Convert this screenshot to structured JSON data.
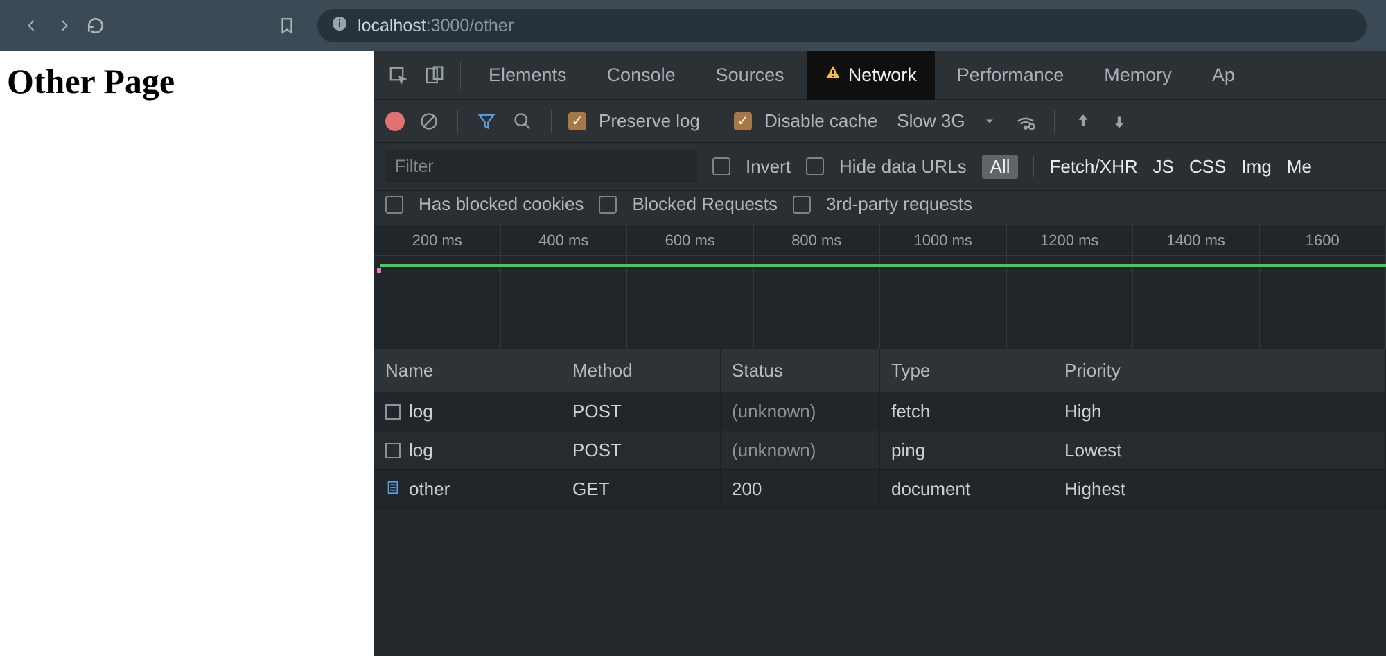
{
  "browser": {
    "url_host": "localhost",
    "url_rest": ":3000/other"
  },
  "page": {
    "heading": "Other Page"
  },
  "devtools": {
    "tabs": {
      "elements": "Elements",
      "console": "Console",
      "sources": "Sources",
      "network": "Network",
      "performance": "Performance",
      "memory": "Memory",
      "app": "Ap"
    },
    "toolbar": {
      "preserve_log": "Preserve log",
      "disable_cache": "Disable cache",
      "throttle": "Slow 3G"
    },
    "filter": {
      "placeholder": "Filter",
      "invert": "Invert",
      "hide_data_urls": "Hide data URLs",
      "types": {
        "all": "All",
        "fetch": "Fetch/XHR",
        "js": "JS",
        "css": "CSS",
        "img": "Img",
        "me": "Me"
      },
      "blocked_cookies": "Has blocked cookies",
      "blocked_requests": "Blocked Requests",
      "third_party": "3rd-party requests"
    },
    "timeline_ticks": [
      "200 ms",
      "400 ms",
      "600 ms",
      "800 ms",
      "1000 ms",
      "1200 ms",
      "1400 ms",
      "1600"
    ],
    "columns": {
      "name": "Name",
      "method": "Method",
      "status": "Status",
      "type": "Type",
      "priority": "Priority"
    },
    "rows": [
      {
        "name": "log",
        "method": "POST",
        "status": "(unknown)",
        "type": "fetch",
        "priority": "High",
        "doc": false
      },
      {
        "name": "log",
        "method": "POST",
        "status": "(unknown)",
        "type": "ping",
        "priority": "Lowest",
        "doc": false
      },
      {
        "name": "other",
        "method": "GET",
        "status": "200",
        "type": "document",
        "priority": "Highest",
        "doc": true
      }
    ]
  }
}
